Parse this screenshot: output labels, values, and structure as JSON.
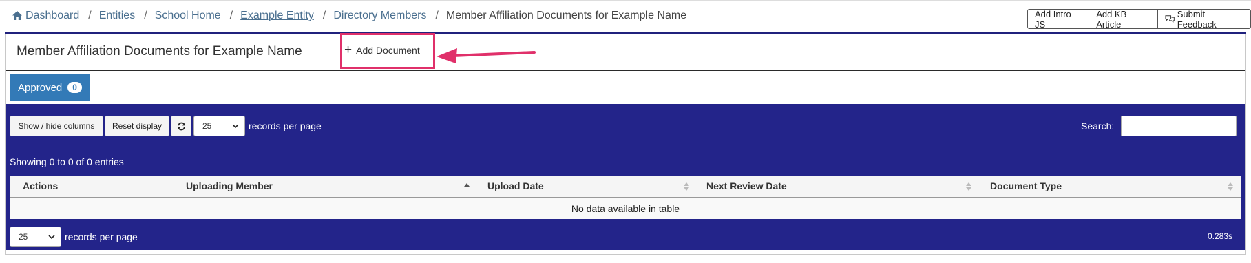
{
  "breadcrumb": {
    "items": [
      {
        "label": "Dashboard"
      },
      {
        "label": "Entities"
      },
      {
        "label": "School Home"
      },
      {
        "label": "Example Entity"
      },
      {
        "label": "Directory Members"
      }
    ],
    "current": "Member Affiliation Documents for Example Name",
    "separator": "/"
  },
  "topbar": {
    "add_intro_label": "Add Intro JS",
    "add_kb_label": "Add KB Article",
    "feedback_label": "Submit Feedback"
  },
  "panel": {
    "title": "Member Affiliation Documents for Example Name",
    "add_document_label": "Add Document",
    "add_document_icon": "+"
  },
  "tabs": {
    "approved_label": "Approved",
    "approved_count": "0"
  },
  "table_controls": {
    "show_hide_label": "Show / hide columns",
    "reset_label": "Reset display",
    "page_size": "25",
    "records_per_page_label": "records per page",
    "search_label": "Search:",
    "search_value": "",
    "showing_text": "Showing 0 to 0 of 0 entries"
  },
  "table": {
    "columns": [
      "Actions",
      "Uploading Member",
      "Upload Date",
      "Next Review Date",
      "Document Type"
    ],
    "empty_text": "No data available in table"
  },
  "footer": {
    "page_size": "25",
    "records_per_page_label": "records per page",
    "timing": "0.283s"
  },
  "colors": {
    "table_bg": "#23248a",
    "accent": "#337ab7",
    "highlight": "#e0306a",
    "link": "#4a6f8f"
  },
  "icons": {
    "home": "home-icon",
    "refresh": "refresh-icon",
    "feedback": "chat-icon",
    "arrow": "arrow-left-annotation"
  }
}
